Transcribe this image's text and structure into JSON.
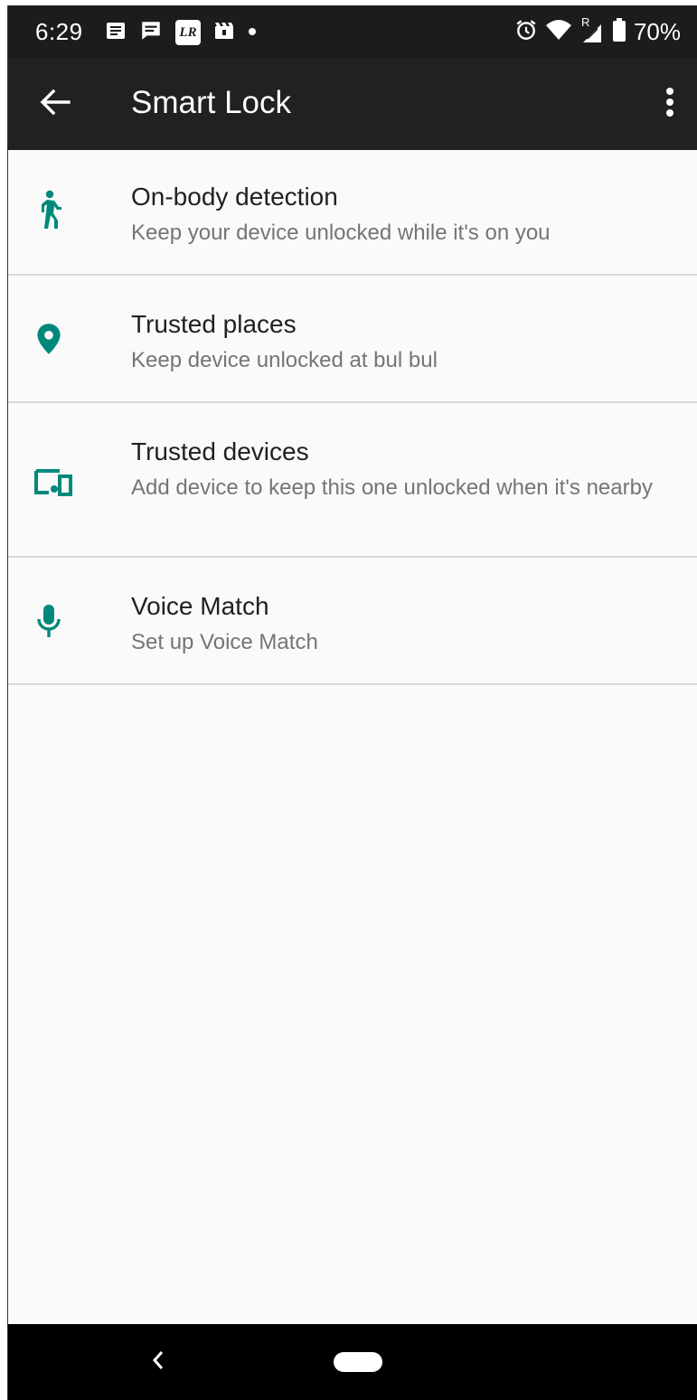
{
  "status_bar": {
    "time": "6:29",
    "battery": "70%",
    "left_icons": [
      "notes-icon",
      "message-icon",
      "lr-app-icon",
      "clapper-icon",
      "dot-icon"
    ],
    "lr_label": "LR",
    "right_icons": [
      "alarm-icon",
      "wifi-icon",
      "signal-roaming-icon",
      "battery-icon"
    ],
    "roaming_mark": "R"
  },
  "app_bar": {
    "title": "Smart Lock",
    "back_icon": "arrow-back-icon",
    "menu_icon": "more-vert-icon"
  },
  "accent_color": "#00897b",
  "items": [
    {
      "title": "On-body detection",
      "subtitle": "Keep your device unlocked while it's on you",
      "icon": "walking-person-icon"
    },
    {
      "title": "Trusted places",
      "subtitle": "Keep device unlocked at bul bul",
      "icon": "location-pin-icon"
    },
    {
      "title": "Trusted devices",
      "subtitle": "Add device to keep this one unlocked when it's nearby",
      "icon": "devices-icon"
    },
    {
      "title": "Voice Match",
      "subtitle": "Set up Voice Match",
      "icon": "microphone-icon"
    }
  ],
  "nav_bar": {
    "back_icon": "nav-back-icon",
    "home_icon": "home-pill-icon"
  }
}
